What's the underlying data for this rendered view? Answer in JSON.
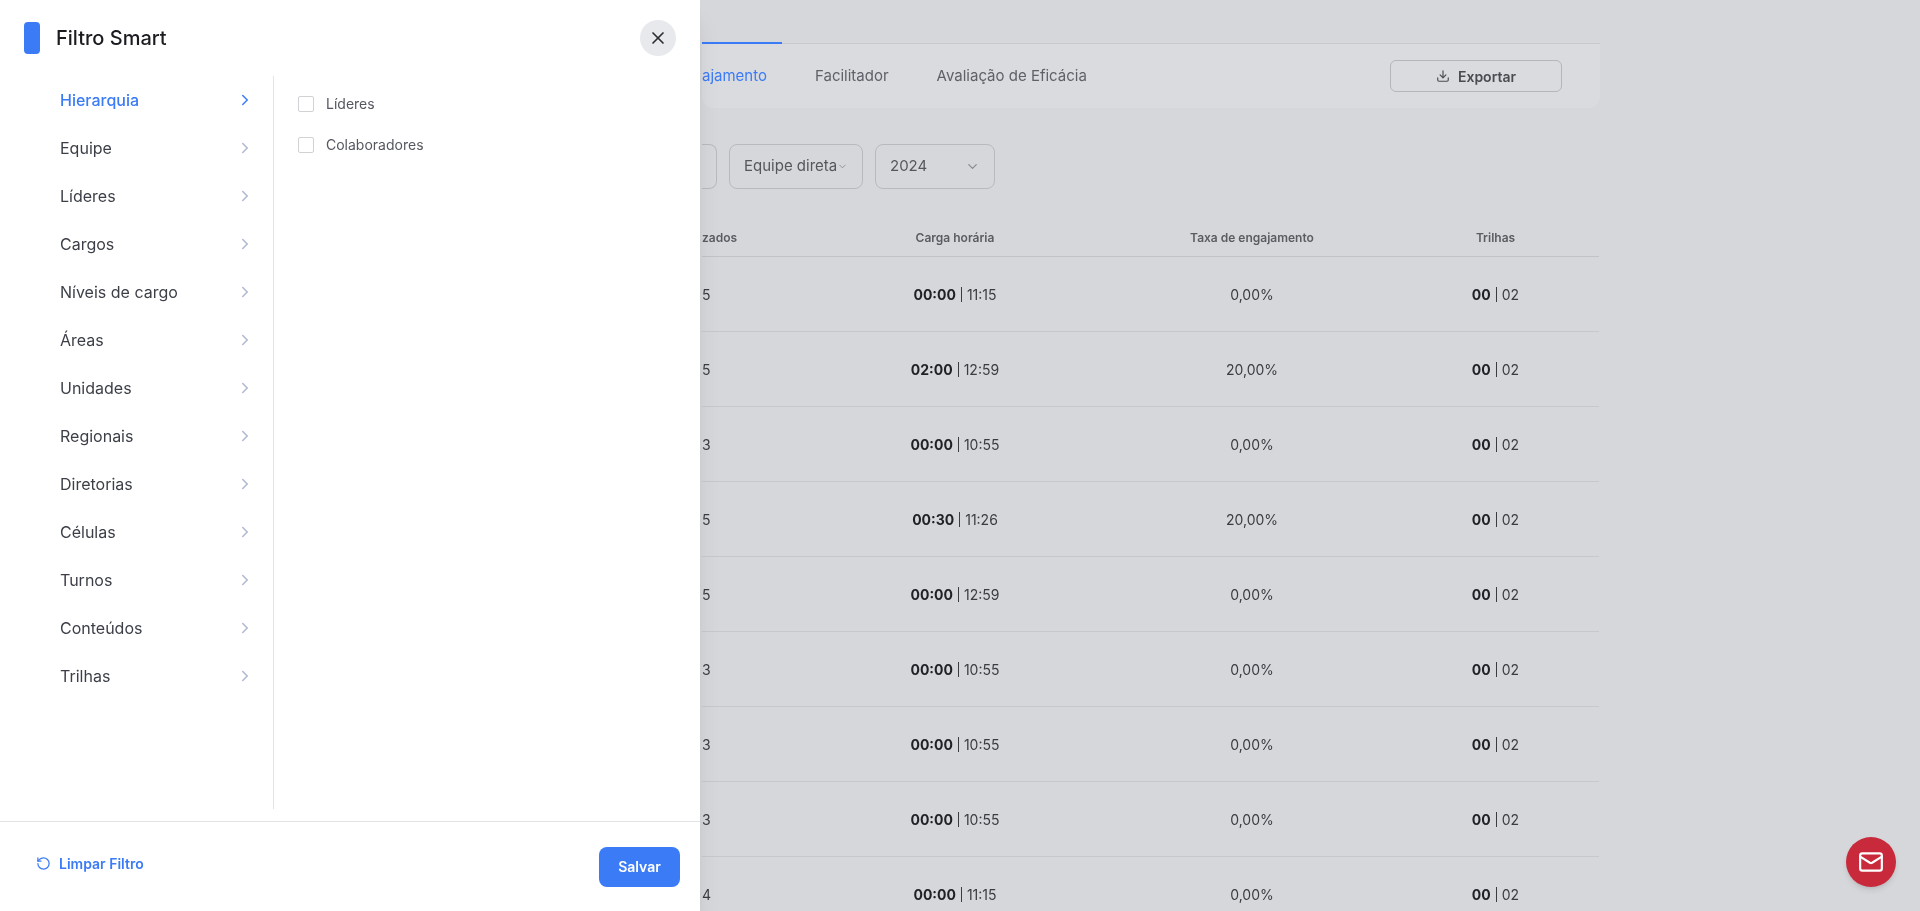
{
  "page": {
    "tabs": [
      {
        "label": "ajamento",
        "selected": true
      },
      {
        "label": "Facilitador",
        "selected": false
      },
      {
        "label": "Avaliação de Eficácia",
        "selected": false
      }
    ],
    "export_button": "Exportar",
    "filters": [
      {
        "value": "Equipe direta"
      },
      {
        "value": "2024"
      }
    ],
    "table": {
      "columns": [
        "zados",
        "Carga horária",
        "Taxa de engajamento",
        "Trilhas"
      ],
      "rows": [
        {
          "column_1": "5",
          "hours_done": "00:00",
          "hours_total": "11:15",
          "rate": "0,00%",
          "tracks_done": "00",
          "tracks_total": "02"
        },
        {
          "column_1": "5",
          "hours_done": "02:00",
          "hours_total": "12:59",
          "rate": "20,00%",
          "tracks_done": "00",
          "tracks_total": "02"
        },
        {
          "column_1": "3",
          "hours_done": "00:00",
          "hours_total": "10:55",
          "rate": "0,00%",
          "tracks_done": "00",
          "tracks_total": "02"
        },
        {
          "column_1": "5",
          "hours_done": "00:30",
          "hours_total": "11:26",
          "rate": "20,00%",
          "tracks_done": "00",
          "tracks_total": "02"
        },
        {
          "column_1": "5",
          "hours_done": "00:00",
          "hours_total": "12:59",
          "rate": "0,00%",
          "tracks_done": "00",
          "tracks_total": "02"
        },
        {
          "column_1": "3",
          "hours_done": "00:00",
          "hours_total": "10:55",
          "rate": "0,00%",
          "tracks_done": "00",
          "tracks_total": "02"
        },
        {
          "column_1": "3",
          "hours_done": "00:00",
          "hours_total": "10:55",
          "rate": "0,00%",
          "tracks_done": "00",
          "tracks_total": "02"
        },
        {
          "column_1": "3",
          "hours_done": "00:00",
          "hours_total": "10:55",
          "rate": "0,00%",
          "tracks_done": "00",
          "tracks_total": "02"
        },
        {
          "column_1": "4",
          "hours_done": "00:00",
          "hours_total": "11:15",
          "rate": "0,00%",
          "tracks_done": "00",
          "tracks_total": "02"
        }
      ]
    }
  },
  "filter_panel": {
    "title": "Filtro Smart",
    "categories": [
      {
        "label": "Hierarquia",
        "selected": true
      },
      {
        "label": "Equipe",
        "selected": false
      },
      {
        "label": "Líderes",
        "selected": false
      },
      {
        "label": "Cargos",
        "selected": false
      },
      {
        "label": "Níveis de cargo",
        "selected": false
      },
      {
        "label": "Áreas",
        "selected": false
      },
      {
        "label": "Unidades",
        "selected": false
      },
      {
        "label": "Regionais",
        "selected": false
      },
      {
        "label": "Diretorias",
        "selected": false
      },
      {
        "label": "Células",
        "selected": false
      },
      {
        "label": "Turnos",
        "selected": false
      },
      {
        "label": "Conteúdos",
        "selected": false
      },
      {
        "label": "Trilhas",
        "selected": false
      }
    ],
    "options": [
      {
        "label": "Líderes",
        "checked": false
      },
      {
        "label": "Colaboradores",
        "checked": false
      }
    ],
    "clear_button": "Limpar Filtro",
    "save_button": "Salvar"
  }
}
